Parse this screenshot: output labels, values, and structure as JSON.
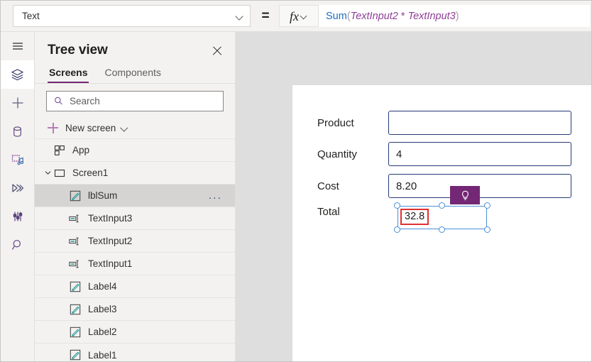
{
  "formula_bar": {
    "property_value": "Text",
    "equals": "=",
    "fx_label": "fx",
    "formula_tokens": [
      {
        "t": "Sum",
        "k": "fn"
      },
      {
        "t": "(",
        "k": "paren"
      },
      {
        "t": "TextInput2",
        "k": "ident"
      },
      {
        "t": " * ",
        "k": "op"
      },
      {
        "t": "TextInput3",
        "k": "ident"
      },
      {
        "t": ")",
        "k": "paren"
      }
    ],
    "formula_text": "Sum(TextInput2 * TextInput3)"
  },
  "rail": {
    "items": [
      {
        "icon": "hamburger-menu-icon",
        "name": "menu",
        "active": false
      },
      {
        "icon": "layers-tree-view-icon",
        "name": "tree-view",
        "active": true
      },
      {
        "icon": "plus-insert-icon",
        "name": "insert",
        "active": false
      },
      {
        "icon": "database-data-icon",
        "name": "data",
        "active": false
      },
      {
        "icon": "media-icon",
        "name": "media",
        "active": false
      },
      {
        "icon": "power-automate-icon",
        "name": "power-automate",
        "active": false
      },
      {
        "icon": "variables-tools-icon",
        "name": "variables",
        "active": false
      },
      {
        "icon": "search-icon",
        "name": "search",
        "active": false
      }
    ]
  },
  "tree_panel": {
    "title": "Tree view",
    "close_label": "Close",
    "tabs": [
      {
        "label": "Screens",
        "selected": true
      },
      {
        "label": "Components",
        "selected": false
      }
    ],
    "search": {
      "placeholder": "Search",
      "value": ""
    },
    "new_screen": {
      "label": "New screen"
    },
    "rows": [
      {
        "label": "App",
        "icon": "app-grid-icon",
        "indent": 0,
        "expander": false,
        "selected": false,
        "menu": false
      },
      {
        "label": "Screen1",
        "icon": "screen-icon",
        "indent": 0,
        "expander": true,
        "selected": false,
        "menu": false
      },
      {
        "label": "lblSum",
        "icon": "label-icon",
        "indent": 1,
        "expander": false,
        "selected": true,
        "menu": true
      },
      {
        "label": "TextInput3",
        "icon": "text-input-icon",
        "indent": 1,
        "expander": false,
        "selected": false,
        "menu": false
      },
      {
        "label": "TextInput2",
        "icon": "text-input-icon",
        "indent": 1,
        "expander": false,
        "selected": false,
        "menu": false
      },
      {
        "label": "TextInput1",
        "icon": "text-input-icon",
        "indent": 1,
        "expander": false,
        "selected": false,
        "menu": false
      },
      {
        "label": "Label4",
        "icon": "label-icon",
        "indent": 1,
        "expander": false,
        "selected": false,
        "menu": false
      },
      {
        "label": "Label3",
        "icon": "label-icon",
        "indent": 1,
        "expander": false,
        "selected": false,
        "menu": false
      },
      {
        "label": "Label2",
        "icon": "label-icon",
        "indent": 1,
        "expander": false,
        "selected": false,
        "menu": false
      },
      {
        "label": "Label1",
        "icon": "label-icon",
        "indent": 1,
        "expander": false,
        "selected": false,
        "menu": false
      }
    ],
    "row_menu_label": "..."
  },
  "canvas": {
    "fields": [
      {
        "label": "Product",
        "value": ""
      },
      {
        "label": "Quantity",
        "value": "4"
      },
      {
        "label": "Cost",
        "value": "8.20"
      },
      {
        "label": "Total",
        "value": ""
      }
    ],
    "selected_control": {
      "name": "lblSum",
      "error_value": "32.8",
      "has_error": true
    },
    "suggestion_badge": {
      "icon": "lightbulb-icon"
    }
  },
  "colors": {
    "accent_purple": "#742774",
    "formula_fn": "#1f6fc4",
    "formula_ident": "#8f3f97",
    "input_border": "#253a77",
    "selection_blue": "#4a90d9",
    "error_red": "#e03030",
    "panel_bg": "#f3f2f1",
    "canvas_backdrop": "#dedede",
    "row_selected": "#d6d4d2",
    "control_icon_teal": "#2f9e9e"
  }
}
